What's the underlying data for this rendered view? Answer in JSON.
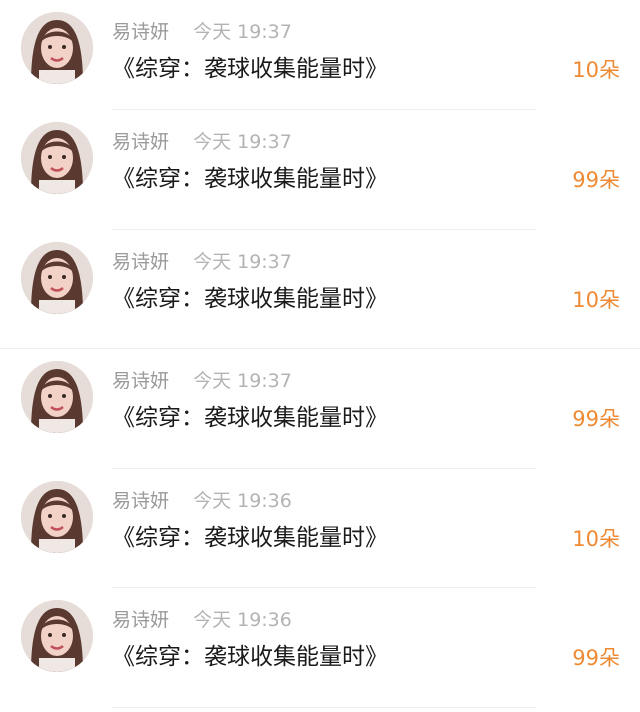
{
  "colors": {
    "accent": "#ef8a33",
    "name": "#9a9a9a",
    "time": "#b3b3b3",
    "text": "#1a1a1a",
    "divider": "#efefef"
  },
  "avatar_icon": "user-avatar-photo",
  "rows": [
    {
      "user": "易诗妍",
      "time": "今天 19:37",
      "text": "《综穿：袭球收集能量时》",
      "count": "10朵"
    },
    {
      "user": "易诗妍",
      "time": "今天 19:37",
      "text": "《综穿：袭球收集能量时》",
      "count": "99朵"
    },
    {
      "user": "易诗妍",
      "time": "今天 19:37",
      "text": "《综穿：袭球收集能量时》",
      "count": "10朵"
    },
    {
      "user": "易诗妍",
      "time": "今天 19:37",
      "text": "《综穿：袭球收集能量时》",
      "count": "99朵"
    },
    {
      "user": "易诗妍",
      "time": "今天 19:36",
      "text": "《综穿：袭球收集能量时》",
      "count": "10朵"
    },
    {
      "user": "易诗妍",
      "time": "今天 19:36",
      "text": "《综穿：袭球收集能量时》",
      "count": "99朵"
    }
  ]
}
